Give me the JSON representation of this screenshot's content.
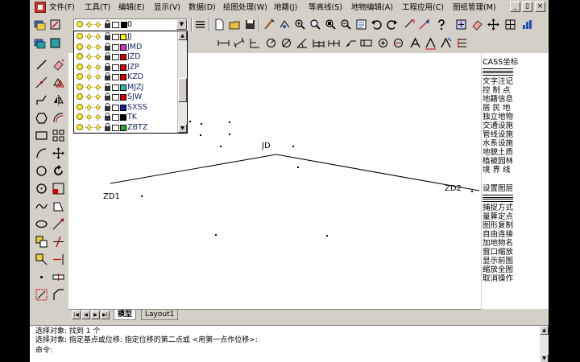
{
  "menu": {
    "items": [
      "文件(F)",
      "工具(T)",
      "编辑(E)",
      "显示(V)",
      "数据(D)",
      "绘图处理(W)",
      "地籍(J)",
      "等高线(S)",
      "地物编辑(A)",
      "工程应用(C)",
      "图纸管理(M)"
    ]
  },
  "window_controls": {
    "minimize": "_",
    "restore": "▯",
    "close": "×"
  },
  "layer_combo": {
    "current": "0"
  },
  "layer_list": [
    {
      "name": "JJ",
      "color": "#ffff00"
    },
    {
      "name": "JMD",
      "color": "#cc33cc"
    },
    {
      "name": "JZD",
      "color": "#dd0000"
    },
    {
      "name": "JZP",
      "color": "#dd0000"
    },
    {
      "name": "KZD",
      "color": "#dd0000"
    },
    {
      "name": "MJZJ",
      "color": "#22bbbb"
    },
    {
      "name": "SJW",
      "color": "#dd0000"
    },
    {
      "name": "SXSS",
      "color": "#1a1aaa"
    },
    {
      "name": "TK",
      "color": "#000000"
    },
    {
      "name": "ZBTZ",
      "color": "#22aa22"
    }
  ],
  "canvas": {
    "labels": {
      "jd": "JD",
      "zd1": "ZD1",
      "zd2": "ZD2"
    }
  },
  "tabs": {
    "model": "模型",
    "layout": "Layout1"
  },
  "right_panel": {
    "title": "CASS坐标",
    "items": [
      "文字注记",
      "控 制 点",
      "地籍信息",
      "居 民 地",
      "独立地物",
      "交通设施",
      "管线设施",
      "水系设施",
      "地貌土质",
      "植被园林",
      "境 界 线"
    ],
    "settings_title": "设置图层",
    "settings_items": [
      "捕捉方式",
      "量算定点",
      "图形复制",
      "自由连接",
      "加地物名",
      "窗口缩放",
      "显示前图",
      "缩放全图",
      "取消操作"
    ]
  },
  "command": {
    "line1": "选择对象:  找到 1 个",
    "line2": "选择对象:   指定基点或位移: 指定位移的第二点或 <用第一点作位移>:",
    "line3": "命令:"
  },
  "colors": {
    "face": "#d4d0c8",
    "canvas": "#ffffff",
    "black_bg": "#000000"
  }
}
